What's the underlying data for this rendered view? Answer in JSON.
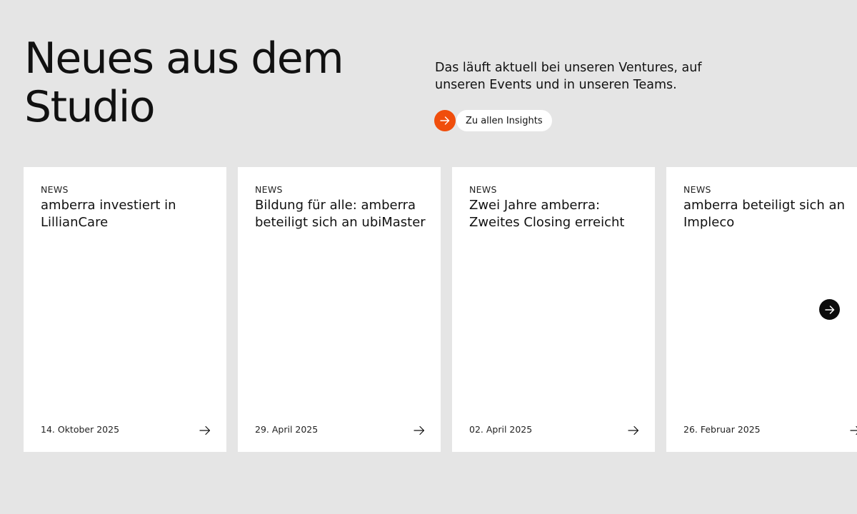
{
  "hero": {
    "title_line1": "Neues aus dem",
    "title_line2": "Studio",
    "intro": "Das läuft aktuell bei unseren Ventures, auf unseren Events und in unseren Teams.",
    "cta_label": "Zu allen Insights",
    "cta_icon": "arrow-right-icon"
  },
  "colors": {
    "accent": "#f04e0c",
    "background": "#e5e5e5",
    "card": "#ffffff"
  },
  "cards": [
    {
      "tag": "NEWS",
      "title": "amberra investiert in LillianCare",
      "date": "14. Oktober 2025"
    },
    {
      "tag": "NEWS",
      "title": "Bildung für alle: amberra beteiligt sich an ubiMaster",
      "date": "29. April 2025"
    },
    {
      "tag": "NEWS",
      "title": "Zwei Jahre amberra: Zweites Closing erreicht",
      "date": "02. April 2025"
    },
    {
      "tag": "NEWS",
      "title": "amberra beteiligt sich an Impleco",
      "date": "26. Februar 2025"
    }
  ],
  "carousel": {
    "next_icon": "arrow-right-icon"
  }
}
